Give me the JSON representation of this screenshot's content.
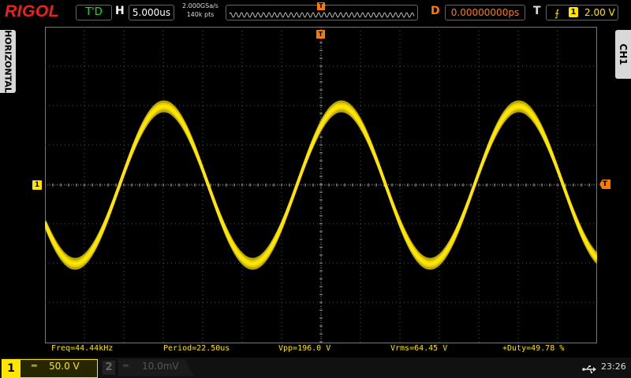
{
  "header": {
    "logo": "RIGOL",
    "run_status": "T'D",
    "horizontal_label": "H",
    "timebase": "5.000us",
    "sample_rate": "2.000GSa/s",
    "memory_depth": "140k pts",
    "delay_label": "D",
    "delay_value": "0.00000000ps",
    "trigger_label": "T",
    "trigger_source": "1",
    "trigger_level": "2.00 V"
  },
  "side_tabs": {
    "left": "HORIZONTAL",
    "right": "CH1"
  },
  "markers": {
    "channel": "1",
    "trigger": "T"
  },
  "measurements": [
    {
      "text": "Freq=44.44kHz"
    },
    {
      "text": "Period=22.50us"
    },
    {
      "text": "Vpp=196.0 V"
    },
    {
      "text": "Vrms=64.45 V"
    },
    {
      "text": "+Duty=49.78 %"
    }
  ],
  "channels": {
    "ch1": {
      "number": "1",
      "coupling": "═",
      "scale": "50.0 V"
    },
    "ch2": {
      "number": "2",
      "coupling": "═",
      "scale": "10.0mV"
    }
  },
  "status": {
    "time": "23:26"
  },
  "colors": {
    "ch1": "#ffe500",
    "trigger": "#ff7a00",
    "logo": "#e8231a",
    "run": "#17e317"
  },
  "icons": {
    "usb": "usb-icon",
    "trigger_edge": "rising-edge-icon"
  }
}
